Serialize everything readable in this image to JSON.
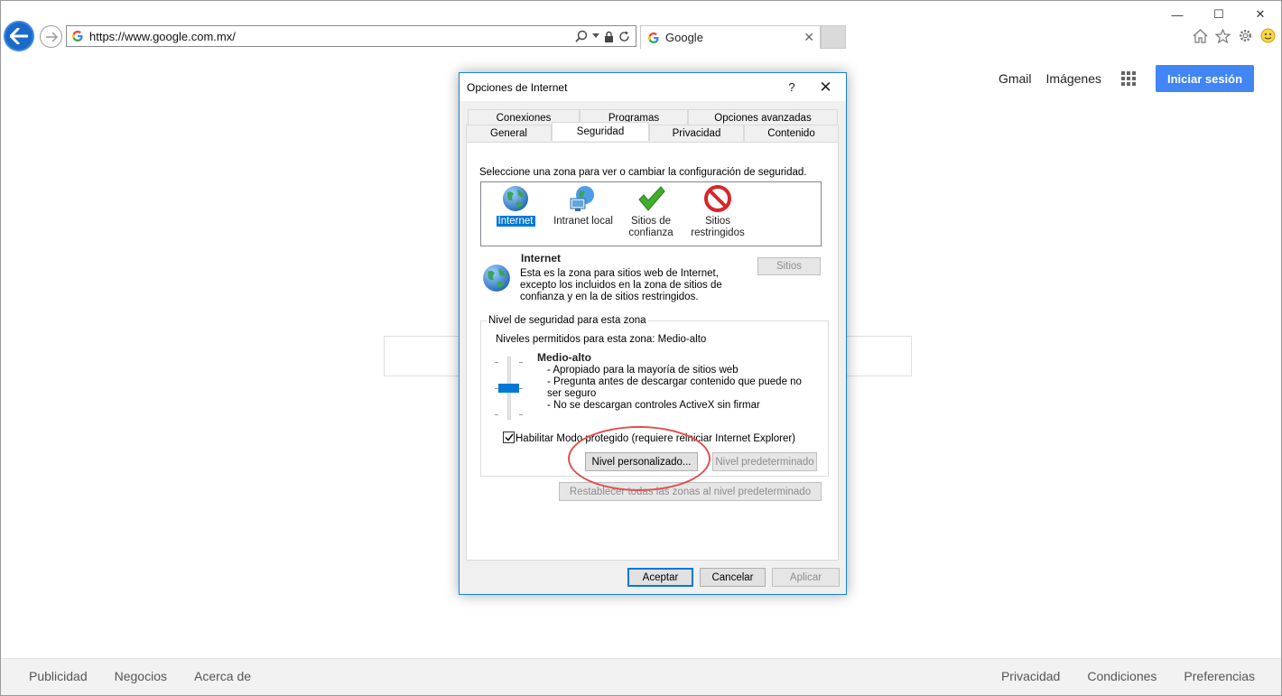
{
  "browser": {
    "window_controls": {
      "minimize": "—",
      "maximize": "☐",
      "close": "✕"
    },
    "address_url": "https://www.google.com.mx/",
    "tab_title": "Google",
    "tab_close": "✕"
  },
  "google": {
    "header_links": [
      "Gmail",
      "Imágenes"
    ],
    "signin_label": "Iniciar sesión",
    "footer_left": [
      "Publicidad",
      "Negocios",
      "Acerca de"
    ],
    "footer_right": [
      "Privacidad",
      "Condiciones",
      "Preferencias"
    ]
  },
  "dialog": {
    "title": "Opciones de Internet",
    "help": "?",
    "close": "✕",
    "tabs_row1": [
      "Conexiones",
      "Programas",
      "Opciones avanzadas"
    ],
    "tabs_row2": [
      "General",
      "Seguridad",
      "Privacidad",
      "Contenido"
    ],
    "active_tab": "Seguridad",
    "zone_instruction": "Seleccione una zona para ver o cambiar la configuración de seguridad.",
    "zones": [
      {
        "label": "Internet",
        "icon": "globe-icon",
        "selected": true
      },
      {
        "label": "Intranet local",
        "icon": "intranet-icon",
        "selected": false
      },
      {
        "label": "Sitios de confianza",
        "icon": "checkmark-icon",
        "selected": false
      },
      {
        "label": "Sitios restringidos",
        "icon": "restricted-icon",
        "selected": false
      }
    ],
    "zone_name": "Internet",
    "zone_description": "Esta es la zona para sitios web de Internet, excepto los incluidos en la zona de sitios de confianza y en la de sitios restringidos.",
    "sites_button": "Sitios",
    "level_group_label": "Nivel de seguridad para esta zona",
    "allowed_levels": "Niveles permitidos para esta zona: Medio-alto",
    "level_name": "Medio-alto",
    "level_bullets": [
      "- Apropiado para la mayoría de sitios web",
      "- Pregunta antes de descargar contenido que puede no ser seguro",
      "- No se descargan controles ActiveX sin firmar"
    ],
    "protected_mode_label": "Habilitar Modo protegido (requiere reiniciar Internet Explorer)",
    "protected_mode_checked": true,
    "custom_level_button": "Nivel personalizado...",
    "default_level_button": "Nivel predeterminado",
    "reset_all_button": "Restablecer todas las zonas al nivel predeterminado",
    "ok_button": "Aceptar",
    "cancel_button": "Cancelar",
    "apply_button": "Aplicar"
  },
  "colors": {
    "accent_blue": "#0078d7",
    "google_blue": "#4285f4",
    "annotation_red": "#e0504e"
  }
}
